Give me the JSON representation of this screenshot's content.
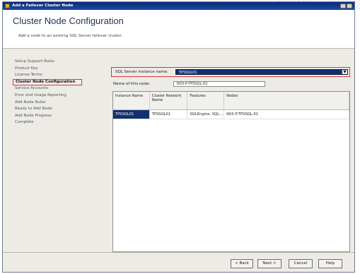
{
  "window": {
    "title": "Add a Failover Cluster Node"
  },
  "header": {
    "title": "Cluster Node Configuration",
    "subtitle": "Add a node to an existing SQL Server failover cluster."
  },
  "nav": {
    "items": [
      {
        "label": "Setup Support Rules"
      },
      {
        "label": "Product Key"
      },
      {
        "label": "License Terms"
      },
      {
        "label": "Cluster Node Configuration"
      },
      {
        "label": "Service Accounts"
      },
      {
        "label": "Error and Usage Reporting"
      },
      {
        "label": "Add Node Rules"
      },
      {
        "label": "Ready to Add Node"
      },
      {
        "label": "Add Node Progress"
      },
      {
        "label": "Complete"
      }
    ],
    "active_index": 3
  },
  "form": {
    "instance_label": "SQL Server instance name:",
    "instance_value": "TPSSQL01",
    "node_label": "Name of this node:",
    "node_value": "N03-P-TPSSQL-02"
  },
  "grid": {
    "headers": [
      "Instance Name",
      "Cluster Network Name",
      "Features",
      "Nodes"
    ],
    "rows": [
      [
        "TPSSQL01",
        "TPSSQL01",
        "SQLEngine, SQL...",
        "N03-P-TPSSQL-01"
      ]
    ]
  },
  "footer": {
    "back": "< Back",
    "next": "Next >",
    "cancel": "Cancel",
    "help": "Help"
  },
  "colors": {
    "selection": "#12306e",
    "highlight_border": "#d23a3a",
    "titlebar": "#0b2a73"
  }
}
